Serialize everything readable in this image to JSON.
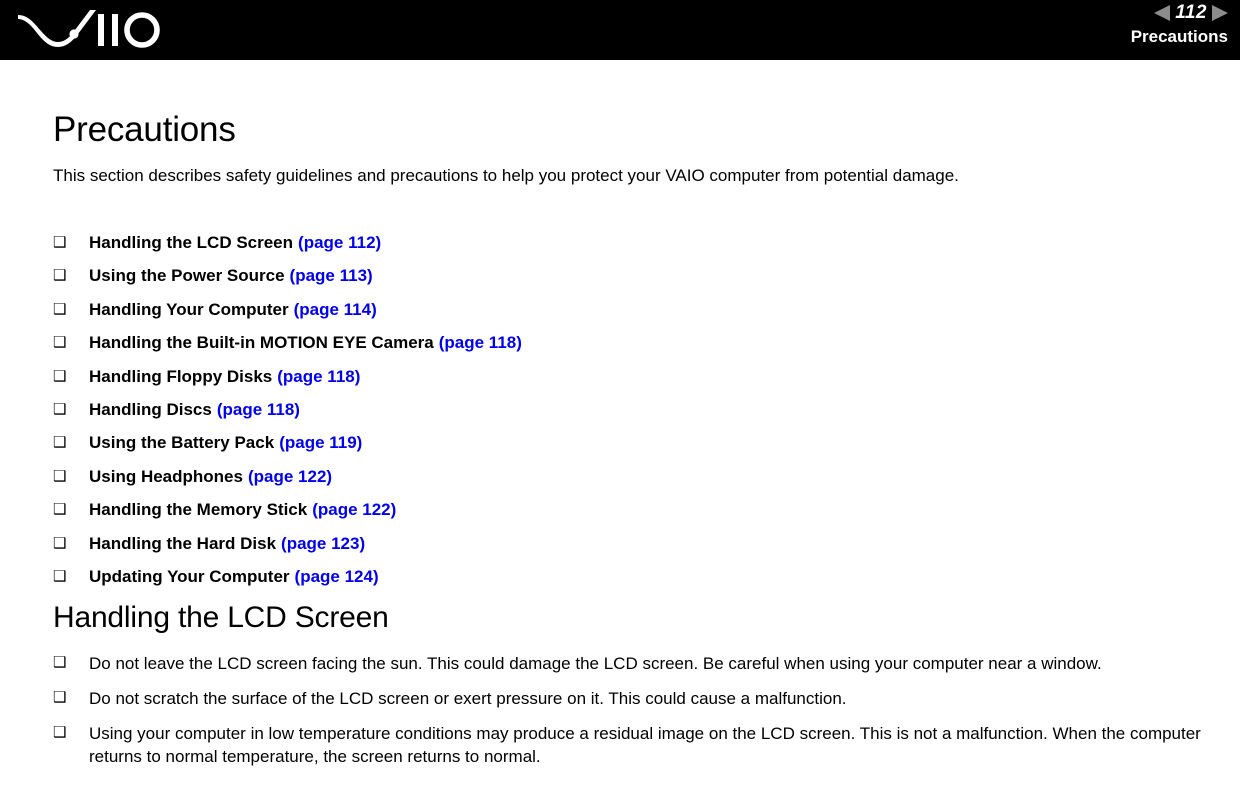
{
  "header": {
    "logo_alt": "VAIO",
    "prev_arrow": "◀",
    "next_arrow": "▶",
    "page_number": "112",
    "section_title": "Precautions",
    "background_color": "#000000",
    "arrow_color": "#8c8c8c",
    "text_color": "#ffffff"
  },
  "page": {
    "title": "Precautions",
    "intro": "This section describes safety guidelines and precautions to help you protect your VAIO computer from potential damage.",
    "bullet_glyph": "❑",
    "link_color": "#0000ee"
  },
  "toc": [
    {
      "label": "Handling the LCD Screen",
      "link": "(page 112)"
    },
    {
      "label": "Using the Power Source",
      "link": "(page 113)"
    },
    {
      "label": "Handling Your Computer",
      "link": "(page 114)"
    },
    {
      "label": "Handling the Built-in MOTION EYE Camera",
      "link": "(page 118)"
    },
    {
      "label": "Handling Floppy Disks",
      "link": "(page 118)"
    },
    {
      "label": "Handling Discs",
      "link": "(page 118)"
    },
    {
      "label": "Using the Battery Pack",
      "link": "(page 119)"
    },
    {
      "label": "Using Headphones",
      "link": "(page 122)"
    },
    {
      "label": "Handling the Memory Stick",
      "link": "(page 122)"
    },
    {
      "label": "Handling the Hard Disk",
      "link": "(page 123)"
    },
    {
      "label": "Updating Your Computer",
      "link": "(page 124)"
    }
  ],
  "section": {
    "heading": "Handling the LCD Screen",
    "items": [
      "Do not leave the LCD screen facing the sun. This could damage the LCD screen. Be careful when using your computer near a window.",
      "Do not scratch the surface of the LCD screen or exert pressure on it. This could cause a malfunction.",
      "Using your computer in low temperature conditions may produce a residual image on the LCD screen. This is not a malfunction. When the computer returns to normal temperature, the screen returns to normal."
    ]
  }
}
